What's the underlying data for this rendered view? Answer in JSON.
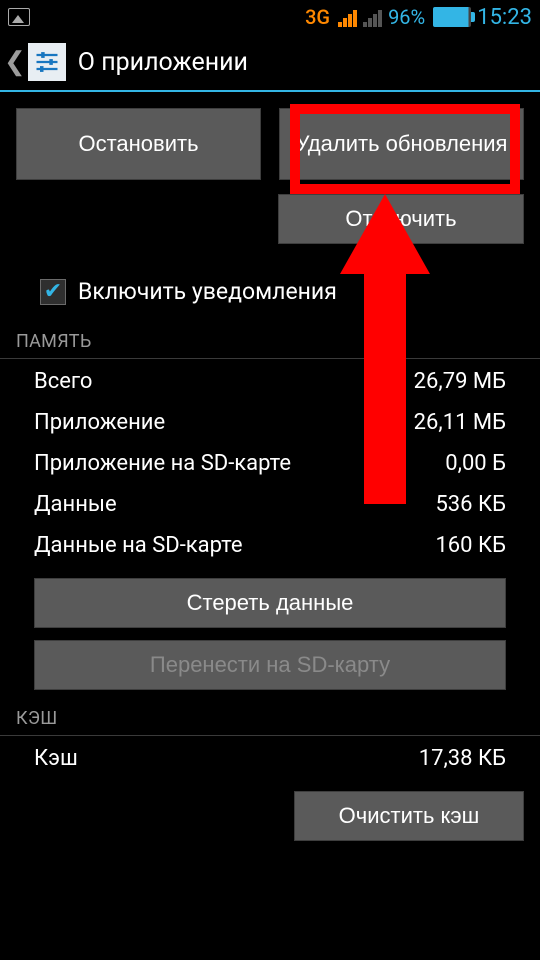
{
  "status": {
    "network_label": "3G",
    "battery_pct": "96%",
    "time": "15:23"
  },
  "header": {
    "title": "О приложении"
  },
  "buttons": {
    "stop": "Остановить",
    "delete_updates": "Удалить обновления",
    "disable": "Отключить",
    "clear_data": "Стереть данные",
    "move_sd": "Перенести на SD-карту",
    "clear_cache": "Очистить кэш"
  },
  "checkbox": {
    "notifications_label": "Включить уведомления",
    "checked": true
  },
  "sections": {
    "memory_header": "ПАМЯТЬ",
    "cache_header": "КЭШ"
  },
  "memory": [
    {
      "label": "Всего",
      "value": "26,79 МБ"
    },
    {
      "label": "Приложение",
      "value": "26,11 МБ"
    },
    {
      "label": "Приложение на SD-карте",
      "value": "0,00 Б"
    },
    {
      "label": "Данные",
      "value": "536 КБ"
    },
    {
      "label": "Данные на SD-карте",
      "value": "160 КБ"
    }
  ],
  "cache": [
    {
      "label": "Кэш",
      "value": "17,38 КБ"
    }
  ]
}
